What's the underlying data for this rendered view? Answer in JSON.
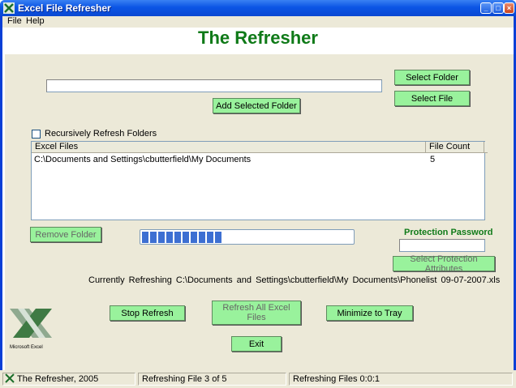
{
  "window": {
    "title": "Excel File Refresher",
    "controls": {
      "minimize": "_",
      "maximize": "□",
      "close": "×"
    }
  },
  "menu": {
    "file": "File",
    "help": "Help"
  },
  "app_title": "The Refresher",
  "folder_input": {
    "value": ""
  },
  "buttons": {
    "select_folder": "Select Folder",
    "select_file": "Select File",
    "add_selected_folder": "Add Selected Folder",
    "remove_folder": "Remove Folder",
    "select_protection_attributes": "Select Protection Attributes",
    "stop_refresh": "Stop Refresh",
    "refresh_all": "Refresh All Excel Files",
    "minimize_to_tray": "Minimize to Tray",
    "exit": "Exit"
  },
  "recursive": {
    "label": "Recursively Refresh Folders",
    "checked": false
  },
  "list": {
    "columns": [
      "Excel Files",
      "File Count"
    ],
    "rows": [
      {
        "path": "C:\\Documents and Settings\\cbutterfield\\My Documents",
        "count": "5"
      }
    ]
  },
  "progress": {
    "value": 0.4,
    "blocks": 11
  },
  "protection_password": {
    "label": "Protection Password",
    "value": ""
  },
  "current_status": "Currently Refreshing C:\\Documents and Settings\\cbutterfield\\My Documents\\Phonelist 09-07-2007.xls",
  "logo": {
    "caption": "Microsoft Excel"
  },
  "status_bar": {
    "app": "The Refresher, 2005",
    "file_progress": "Refreshing File 3 of 5",
    "files_time": "Refreshing Files  0:0:1"
  },
  "colors": {
    "title_green": "#0f7a18",
    "button_green": "#99f29c",
    "progress_blue": "#3d6fd2",
    "xp_blue": "#0b55e5"
  }
}
